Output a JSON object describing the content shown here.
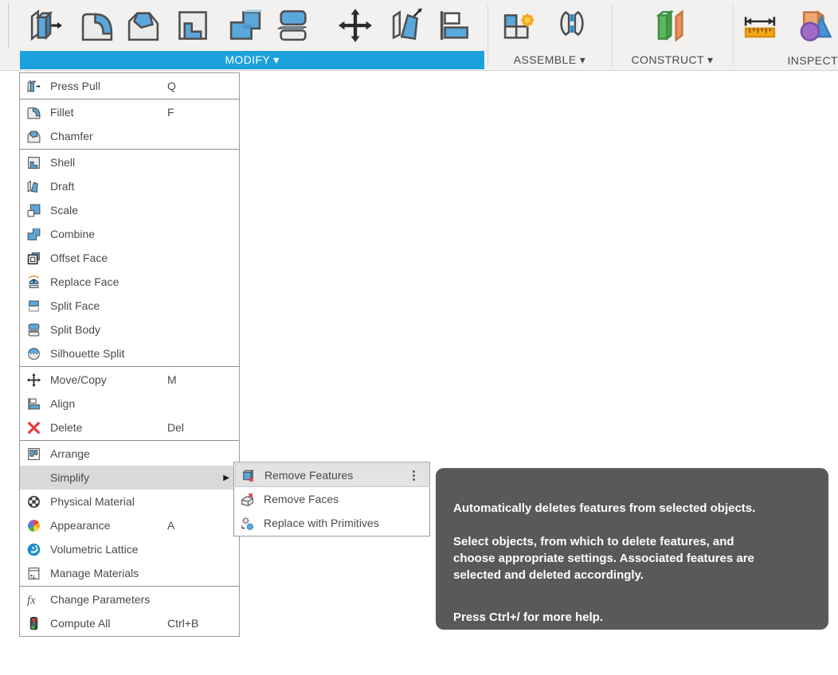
{
  "colors": {
    "accent_blue": "#1ba2dc",
    "icon_blue": "#5aa7db",
    "menu_highlight": "#d9d9d9",
    "submenu_highlight": "#e3e3e3",
    "tooltip_background": "#59595b",
    "delete_red": "#e23b3b",
    "toolbar_background": "#f2f1f0"
  },
  "toolbar": {
    "modify": {
      "label": "MODIFY ▾",
      "icons": [
        "press-pull-icon",
        "fillet-icon",
        "chamfer-icon",
        "shell-icon",
        "combine-icon",
        "split-body-icon",
        "move-copy-icon",
        "draft-icon",
        "align-icon"
      ]
    },
    "assemble": {
      "label": "ASSEMBLE ▾",
      "icons": [
        "new-component-icon",
        "joint-icon"
      ]
    },
    "construct": {
      "label": "CONSTRUCT ▾",
      "icons": [
        "construction-plane-icon"
      ]
    },
    "inspect": {
      "label": "INSPECT",
      "icons": [
        "measure-icon",
        "analysis-icon"
      ]
    }
  },
  "menu": {
    "submenu_arrow": "▶",
    "items": [
      {
        "label": "Press Pull",
        "shortcut": "Q",
        "icon": "press-pull-icon"
      },
      {
        "label": "Fillet",
        "shortcut": "F",
        "icon": "fillet-icon"
      },
      {
        "label": "Chamfer",
        "shortcut": "",
        "icon": "chamfer-icon"
      },
      {
        "label": "Shell",
        "shortcut": "",
        "icon": "shell-icon"
      },
      {
        "label": "Draft",
        "shortcut": "",
        "icon": "draft-icon"
      },
      {
        "label": "Scale",
        "shortcut": "",
        "icon": "scale-icon"
      },
      {
        "label": "Combine",
        "shortcut": "",
        "icon": "combine-icon"
      },
      {
        "label": "Offset Face",
        "shortcut": "",
        "icon": "offset-face-icon"
      },
      {
        "label": "Replace Face",
        "shortcut": "",
        "icon": "replace-face-icon"
      },
      {
        "label": "Split Face",
        "shortcut": "",
        "icon": "split-face-icon"
      },
      {
        "label": "Split Body",
        "shortcut": "",
        "icon": "split-body-icon"
      },
      {
        "label": "Silhouette Split",
        "shortcut": "",
        "icon": "silhouette-split-icon"
      },
      {
        "label": "Move/Copy",
        "shortcut": "M",
        "icon": "move-copy-icon"
      },
      {
        "label": "Align",
        "shortcut": "",
        "icon": "align-icon"
      },
      {
        "label": "Delete",
        "shortcut": "Del",
        "icon": "delete-icon"
      },
      {
        "label": "Arrange",
        "shortcut": "",
        "icon": "arrange-icon"
      },
      {
        "label": "Simplify",
        "shortcut": "",
        "icon": "",
        "highlighted": true,
        "has_submenu": true
      },
      {
        "label": "Physical Material",
        "shortcut": "",
        "icon": "physical-material-icon"
      },
      {
        "label": "Appearance",
        "shortcut": "A",
        "icon": "appearance-icon"
      },
      {
        "label": "Volumetric Lattice",
        "shortcut": "",
        "icon": "volumetric-lattice-icon"
      },
      {
        "label": "Manage Materials",
        "shortcut": "",
        "icon": "manage-materials-icon"
      },
      {
        "label": "Change Parameters",
        "shortcut": "",
        "icon": "change-parameters-icon"
      },
      {
        "label": "Compute All",
        "shortcut": "Ctrl+B",
        "icon": "compute-all-icon"
      }
    ]
  },
  "submenu": {
    "overflow_glyph": "⋮",
    "items": [
      {
        "label": "Remove Features",
        "icon": "remove-features-icon",
        "highlighted": true
      },
      {
        "label": "Remove Faces",
        "icon": "remove-faces-icon"
      },
      {
        "label": "Replace with Primitives",
        "icon": "replace-with-primitives-icon"
      }
    ]
  },
  "tooltip": {
    "paragraphs": [
      "Automatically deletes features from selected objects.",
      [
        "Select objects, from which to delete features, and",
        "choose appropriate settings. Associated features are",
        "selected and deleted accordingly."
      ],
      "Press Ctrl+/ for more help."
    ]
  }
}
